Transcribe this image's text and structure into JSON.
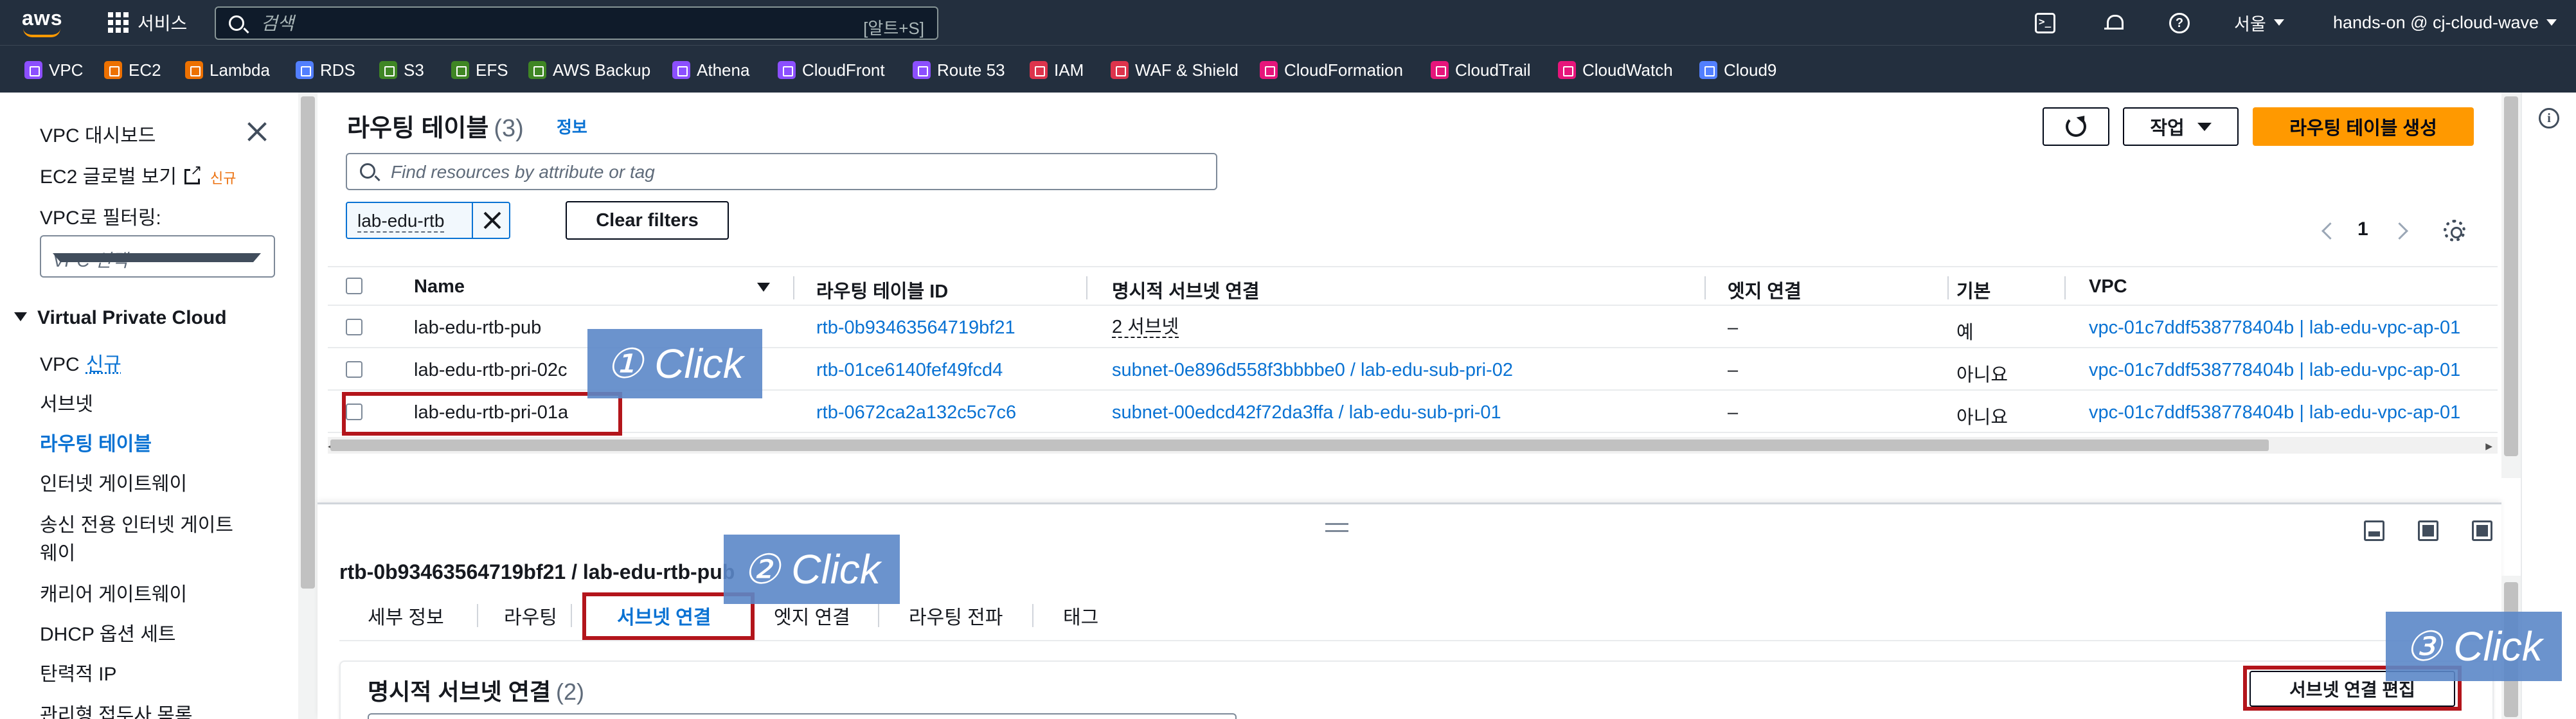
{
  "topnav": {
    "logo_text": "aws",
    "services_label": "서비스",
    "search_placeholder": "검색",
    "search_hint": "[알트+S]",
    "region": "서울",
    "account": "hands-on @ cj-cloud-wave"
  },
  "favorites": [
    {
      "label": "VPC",
      "color": "#8c4fff"
    },
    {
      "label": "EC2",
      "color": "#ed7100"
    },
    {
      "label": "Lambda",
      "color": "#ed7100"
    },
    {
      "label": "RDS",
      "color": "#527fff"
    },
    {
      "label": "S3",
      "color": "#3f8624"
    },
    {
      "label": "EFS",
      "color": "#3f8624"
    },
    {
      "label": "AWS Backup",
      "color": "#3f8624"
    },
    {
      "label": "Athena",
      "color": "#8c4fff"
    },
    {
      "label": "CloudFront",
      "color": "#8c4fff"
    },
    {
      "label": "Route 53",
      "color": "#8c4fff"
    },
    {
      "label": "IAM",
      "color": "#dd344c"
    },
    {
      "label": "WAF & Shield",
      "color": "#dd344c"
    },
    {
      "label": "CloudFormation",
      "color": "#e7157b"
    },
    {
      "label": "CloudTrail",
      "color": "#e7157b"
    },
    {
      "label": "CloudWatch",
      "color": "#e7157b"
    },
    {
      "label": "Cloud9",
      "color": "#527fff"
    }
  ],
  "sidebar": {
    "dashboard": "VPC 대시보드",
    "ec2_global": "EC2 글로벌 보기",
    "new_badge": "신규",
    "filter_label": "VPC로 필터링:",
    "filter_placeholder": "VPC 선택",
    "section": "Virtual Private Cloud",
    "vpc": "VPC",
    "vpc_new": "신규",
    "items": [
      "서브넷",
      "라우팅 테이블",
      "인터넷 게이트웨이",
      "송신 전용 인터넷 게이트",
      "웨이",
      "캐리어 게이트웨이",
      "DHCP 옵션 세트",
      "탄력적 IP",
      "관리형 접두사 목록"
    ]
  },
  "main": {
    "title": "라우팅 테이블",
    "count": "(3)",
    "info": "정보",
    "action_label": "작업",
    "create_label": "라우팅 테이블 생성",
    "filter_placeholder": "Find resources by attribute or tag",
    "filter_token": "lab-edu-rtb",
    "clear_filters": "Clear filters",
    "page": "1"
  },
  "table": {
    "columns": [
      "Name",
      "라우팅 테이블 ID",
      "명시적 서브넷 연결",
      "엣지 연결",
      "기본",
      "VPC"
    ],
    "rows": [
      {
        "name": "lab-edu-rtb-pub",
        "id": "rtb-0b93463564719bf21",
        "subnets": "2 서브넷",
        "edge": "–",
        "main": "예",
        "vpc": "vpc-01c7ddf538778404b | lab-edu-vpc-ap-01"
      },
      {
        "name": "lab-edu-rtb-pri-02c",
        "id": "rtb-01ce6140fef49fcd4",
        "subnets": "subnet-0e896d558f3bbbbe0 / lab-edu-sub-pri-02",
        "edge": "–",
        "main": "아니요",
        "vpc": "vpc-01c7ddf538778404b | lab-edu-vpc-ap-01"
      },
      {
        "name": "lab-edu-rtb-pri-01a",
        "id": "rtb-0672ca2a132c5c7c6",
        "subnets": "subnet-00edcd42f72da3ffa / lab-edu-sub-pri-01",
        "edge": "–",
        "main": "아니요",
        "vpc": "vpc-01c7ddf538778404b | lab-edu-vpc-ap-01"
      }
    ]
  },
  "split": {
    "title": "rtb-0b93463564719bf21 / lab-edu-rtb-pub",
    "tabs": [
      "세부 정보",
      "라우팅",
      "서브넷 연결",
      "엣지 연결",
      "라우팅 전파",
      "태그"
    ],
    "active_tab": "서브넷 연결",
    "section_title": "명시적 서브넷 연결",
    "section_count": "(2)",
    "edit_button": "서브넷 연결 편집"
  },
  "annotations": {
    "step1": "① Click",
    "step2": "② Click",
    "step3": "③ Click"
  }
}
